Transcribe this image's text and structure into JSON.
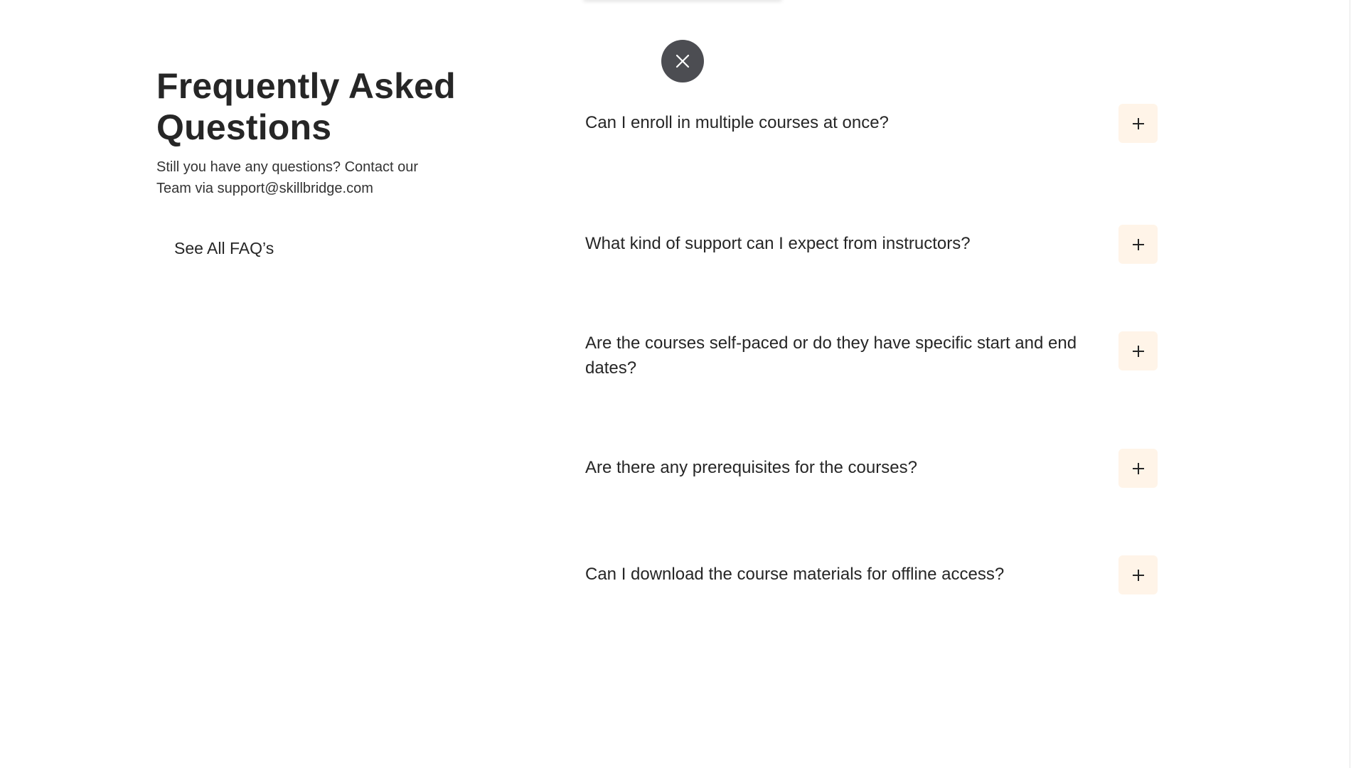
{
  "close": {
    "icon": "close-icon"
  },
  "faq": {
    "title_line1": "Frequently Asked",
    "title_line2": "Questions",
    "subtitle_line1": "Still you have any questions? Contact our",
    "subtitle_line2": "Team via support@skillbridge.com",
    "see_all_label": "See All FAQ’s",
    "items": [
      {
        "question": "Can I enroll in multiple courses at once?",
        "expanded": false,
        "icon": "plus-icon"
      },
      {
        "question": "What kind of support can I expect from instructors?",
        "expanded": false,
        "icon": "plus-icon"
      },
      {
        "question": "Are the courses self-paced or do they have specific start and end dates?",
        "expanded": false,
        "icon": "plus-icon"
      },
      {
        "question": "Are there any prerequisites for the courses?",
        "expanded": false,
        "icon": "plus-icon"
      },
      {
        "question": "Can I download the course materials for offline access?",
        "expanded": false,
        "icon": "plus-icon"
      }
    ]
  },
  "colors": {
    "text": "#262626",
    "close_button_bg": "#4c4d52",
    "plus_button_bg": "#fff4e8"
  }
}
